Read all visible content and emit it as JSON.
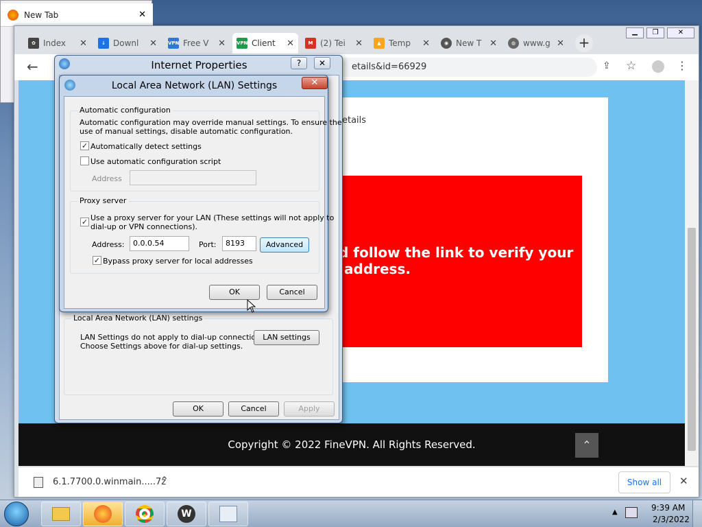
{
  "firefox_window": {
    "tab_title": "New Tab"
  },
  "chrome": {
    "tabs": [
      {
        "label": "Index",
        "icon": "index-icon"
      },
      {
        "label": "Downl",
        "icon": "download-icon"
      },
      {
        "label": "Free V",
        "icon": "vpn-icon"
      },
      {
        "label": "Client",
        "icon": "vpn-icon",
        "active": true
      },
      {
        "label": "(2) Tei",
        "icon": "gmail-icon"
      },
      {
        "label": "Temp",
        "icon": "temp-icon"
      },
      {
        "label": "New T",
        "icon": "chrome-icon"
      },
      {
        "label": "www.g",
        "icon": "globe-icon"
      }
    ],
    "new_tab": "+",
    "url_fragment": "etails&id=66929",
    "page": {
      "details_text": "etails",
      "red_line1": "d follow the link to verify your",
      "red_line2": "address.",
      "footer": "Copyright © 2022 FineVPN. All Rights Reserved."
    },
    "download": {
      "filename": "6.1.7700.0.winmain.....7z",
      "show_all": "Show all"
    }
  },
  "internet_properties": {
    "title": "Internet Properties",
    "help": "?",
    "lan_group_label": "Local Area Network (LAN) settings",
    "lan_note_line1": "LAN Settings do not apply to dial-up connections.",
    "lan_note_line2": "Choose Settings above for dial-up settings.",
    "lan_button": "LAN settings",
    "ok": "OK",
    "cancel": "Cancel",
    "apply": "Apply"
  },
  "lan_dialog": {
    "title": "Local Area Network (LAN) Settings",
    "auto_group": "Automatic configuration",
    "auto_desc_line1": "Automatic configuration may override manual settings.  To ensure the",
    "auto_desc_line2": "use of manual settings, disable automatic configuration.",
    "auto_detect": {
      "label": "Automatically detect settings",
      "checked": true
    },
    "auto_script": {
      "label": "Use automatic configuration script",
      "checked": false
    },
    "address_label": "Address",
    "address_value": "",
    "proxy_group": "Proxy server",
    "use_proxy_line1": "Use a proxy server for your LAN (These settings will not apply to",
    "use_proxy_line2": "dial-up or VPN connections).",
    "use_proxy_checked": true,
    "proxy_address_label": "Address:",
    "proxy_address_value": "0.0.0.54",
    "port_label": "Port:",
    "port_value": "8193",
    "advanced": "Advanced",
    "bypass": {
      "label": "Bypass proxy server for local addresses",
      "checked": true
    },
    "ok": "OK",
    "cancel": "Cancel",
    "check_mark": "✓"
  },
  "taskbar": {
    "apps": [
      "start-orb",
      "explorer",
      "firefox",
      "chrome",
      "winrar",
      "network-settings"
    ],
    "time": "9:39 AM",
    "date": "2/3/2022"
  },
  "colors": {
    "accent_red": "#ff0000",
    "page_blue": "#6fc2f0",
    "footer": "#111111"
  }
}
